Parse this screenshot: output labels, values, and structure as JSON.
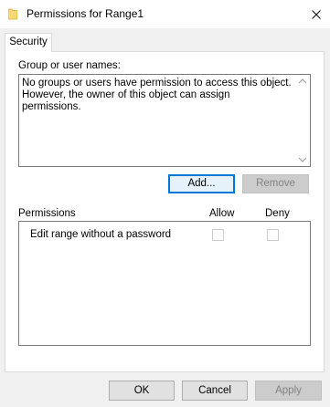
{
  "window": {
    "title": "Permissions for Range1",
    "icon": "folder-icon",
    "close_icon": "close-icon"
  },
  "tabs": [
    {
      "label": "Security",
      "selected": true
    }
  ],
  "group_section": {
    "label": "Group or user names:",
    "message": "No groups or users have permission to access this object. However, the owner of this object can assign permissions."
  },
  "group_buttons": {
    "add_label": "Add...",
    "remove_label": "Remove",
    "remove_enabled": false
  },
  "permissions": {
    "header_label": "Permissions",
    "allow_header": "Allow",
    "deny_header": "Deny",
    "rows": [
      {
        "label": "Edit range without a password",
        "allow": false,
        "deny": false,
        "enabled": false
      }
    ]
  },
  "footer": {
    "ok_label": "OK",
    "cancel_label": "Cancel",
    "apply_label": "Apply",
    "apply_enabled": false
  },
  "colors": {
    "accent": "#0078d7",
    "folder": "#f8d775",
    "window_bg": "#f0f0f0"
  }
}
